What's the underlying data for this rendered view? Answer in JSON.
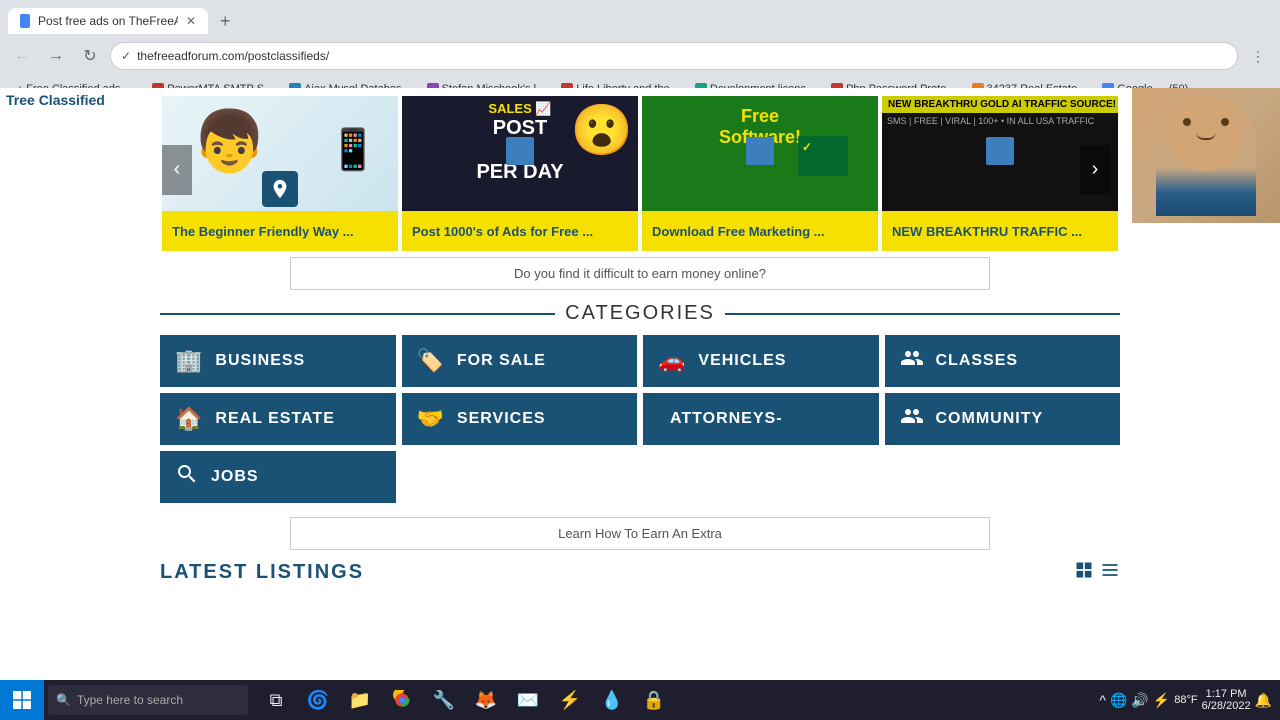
{
  "browser": {
    "tab_title": "Post free ads on TheFreeAdForum...",
    "url": "thefreeadforum.com/postclassifieds/",
    "nav_back": "←",
    "nav_forward": "→",
    "nav_refresh": "↻"
  },
  "bookmarks": [
    {
      "label": "Free Classified ads -...",
      "color": "#4285f4"
    },
    {
      "label": "PowerMTA SMTP S...",
      "color": "#c0392b"
    },
    {
      "label": "Ajax Mysql Databas...",
      "color": "#2980b9"
    },
    {
      "label": "Stefan Mischook's l...",
      "color": "#8e44ad"
    },
    {
      "label": "Life Liberty and the...",
      "color": "#c0392b"
    },
    {
      "label": "Development licenc...",
      "color": "#16a085"
    },
    {
      "label": "Php Password Prote...",
      "color": "#c0392b"
    },
    {
      "label": "34237 Real Estate...",
      "color": "#e67e22"
    },
    {
      "label": "Google",
      "color": "#4285f4"
    },
    {
      "label": "(50)",
      "color": "#4285f4"
    }
  ],
  "carousel": {
    "prev_label": "‹",
    "next_label": "›",
    "items": [
      {
        "caption": "The Beginner Friendly Way ...",
        "img_alt": "person with tablet"
      },
      {
        "caption": "Post 1000's of Ads for Free ...",
        "img_alt": "sales chart post 1k per day"
      },
      {
        "caption": "Download Free Marketing ...",
        "img_alt": "free software green"
      },
      {
        "caption": "NEW BREAKTHRU TRAFFIC ...",
        "img_alt": "new breakthru traffic"
      }
    ]
  },
  "promo": {
    "text": "Do you find it difficult to earn money online?"
  },
  "categories": {
    "title": "CATEGORIES",
    "items": [
      {
        "label": "BUSINESS",
        "icon": "🏢"
      },
      {
        "label": "FOR SALE",
        "icon": "🏷️"
      },
      {
        "label": "VEHICLES",
        "icon": "🚗"
      },
      {
        "label": "CLASSES",
        "icon": "👥"
      },
      {
        "label": "REAL ESTATE",
        "icon": "🏠"
      },
      {
        "label": "SERVICES",
        "icon": "🤝"
      },
      {
        "label": "ATTORNEYS-",
        "icon": ""
      },
      {
        "label": "COMMUNITY",
        "icon": "👥"
      },
      {
        "label": "JOBS",
        "icon": "🔍"
      }
    ]
  },
  "learn_bar": {
    "text": "Learn How To Earn An Extra"
  },
  "latest": {
    "title": "LATEST LISTINGS",
    "grid_icon": "⊞",
    "list_icon": "☰"
  },
  "taskbar": {
    "search_placeholder": "Type here to search",
    "time": "1:17 PM",
    "date": "6/28/2022",
    "temp": "88°F"
  },
  "tree_classified": {
    "label": "Tree Classified"
  }
}
